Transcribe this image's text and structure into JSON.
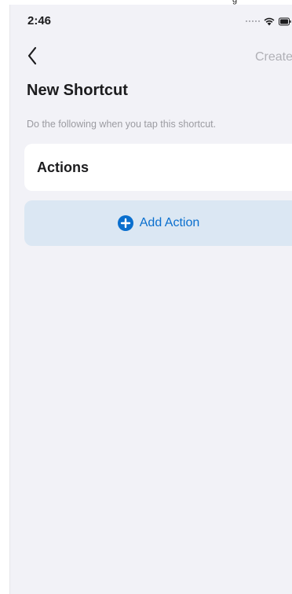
{
  "status_bar": {
    "time": "2:46",
    "signal_icon": "cellular-dots-icon",
    "wifi_icon": "wifi-icon",
    "battery_icon": "battery-icon"
  },
  "nav": {
    "back_icon": "chevron-left-icon",
    "create_label": "Create"
  },
  "page": {
    "title": "New Shortcut",
    "subtitle": "Do the following when you tap this shortcut."
  },
  "actions_section": {
    "label": "Actions"
  },
  "add_action": {
    "label": "Add Action",
    "icon": "plus-circle-icon"
  },
  "colors": {
    "background": "#f2f2f7",
    "accent": "#0a6fce",
    "add_action_fill": "#dbe7f3",
    "disabled_text": "#b0b0b6"
  }
}
